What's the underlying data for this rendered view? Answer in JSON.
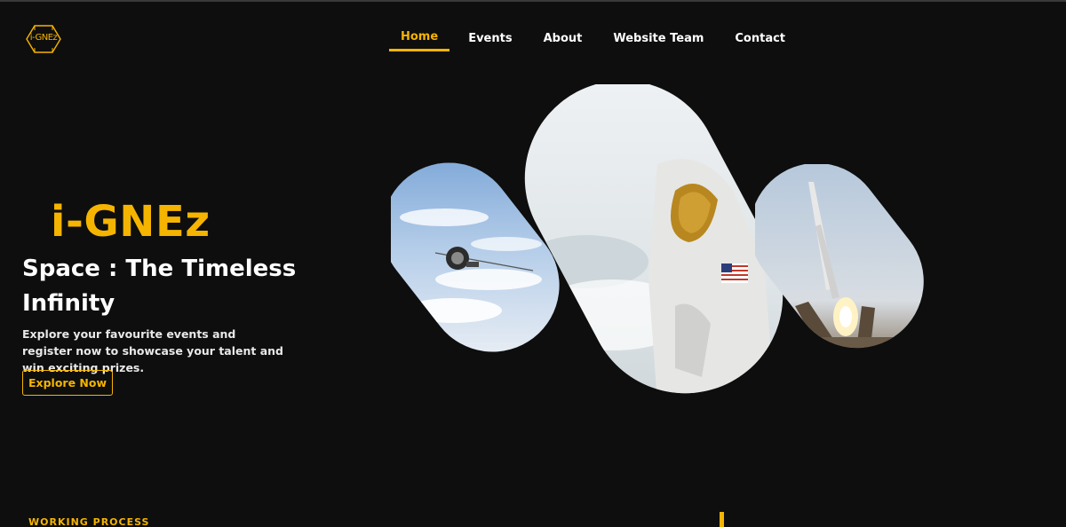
{
  "brand": {
    "logo_text": "i-GNEz",
    "logo_icon": "hexagon-logo-icon"
  },
  "nav": {
    "items": [
      {
        "label": "Home",
        "active": true
      },
      {
        "label": "Events",
        "active": false
      },
      {
        "label": "About",
        "active": false
      },
      {
        "label": "Website Team",
        "active": false
      },
      {
        "label": "Contact",
        "active": false
      }
    ]
  },
  "hero": {
    "brand_name": "i-GNEz",
    "title": "Space : The Timeless Infinity",
    "description": "Explore your favourite events and register now to showcase your talent and win exciting prizes.",
    "cta_label": "Explore Now",
    "images": [
      {
        "name": "satellite-image",
        "subject": "satellite over clouds"
      },
      {
        "name": "astronaut-image",
        "subject": "astronaut in white spacesuit"
      },
      {
        "name": "rocket-launch-image",
        "subject": "rocket launch"
      }
    ]
  },
  "section_preview": {
    "label": "WORKING PROCESS"
  },
  "colors": {
    "accent": "#f5b400",
    "background": "#0e0e0e",
    "text": "#ffffff"
  }
}
